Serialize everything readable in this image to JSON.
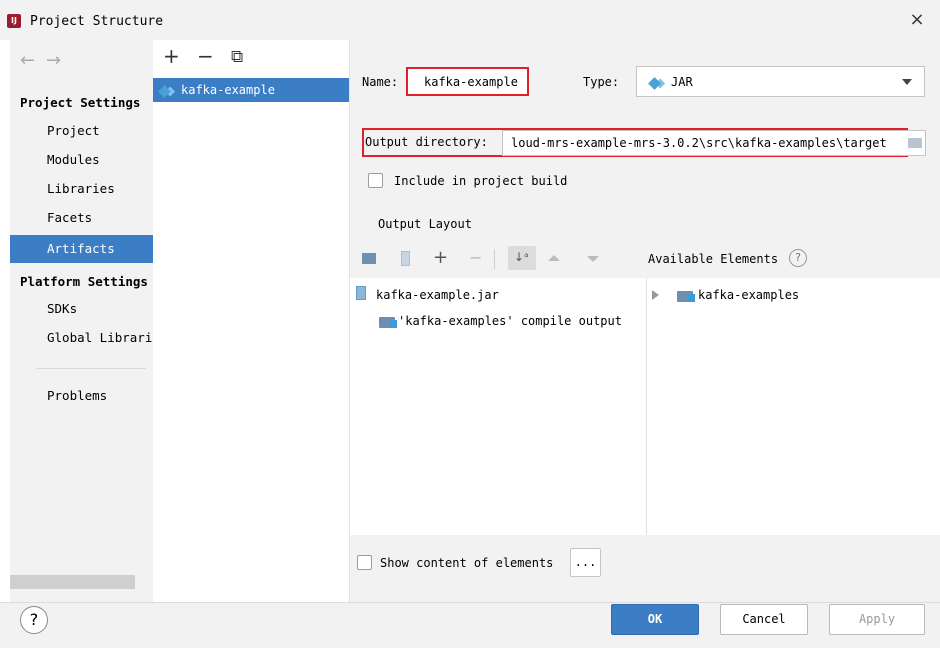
{
  "window": {
    "title": "Project Structure",
    "close_icon": "×"
  },
  "nav": {
    "back_icon": "←",
    "forward_icon": "→",
    "project_settings_heading": "Project Settings",
    "project_settings_items": [
      "Project",
      "Modules",
      "Libraries",
      "Facets",
      "Artifacts"
    ],
    "platform_settings_heading": "Platform Settings",
    "platform_settings_items": [
      "SDKs",
      "Global Librarie"
    ],
    "problems": "Problems",
    "selected": "Artifacts"
  },
  "artifact_list": {
    "add_icon": "+",
    "remove_icon": "−",
    "copy_icon": "⧉",
    "items": [
      "kafka-example"
    ]
  },
  "form": {
    "name_label": "Name:",
    "name_value": "kafka-example",
    "type_label": "Type:",
    "type_value": "JAR",
    "output_dir_label": "Output directory:",
    "output_dir_value": "loud-mrs-example-mrs-3.0.2\\src\\kafka-examples\\target",
    "include_build_label": "Include in project build",
    "include_build_checked": false,
    "output_layout_label": "Output Layout"
  },
  "layout_tree": {
    "root": "kafka-example.jar",
    "child": "'kafka-examples' compile output"
  },
  "available": {
    "heading": "Available Elements",
    "help_icon": "?",
    "items": [
      "kafka-examples"
    ]
  },
  "show_content": {
    "label": "Show content of elements",
    "checked": false,
    "more_button": "..."
  },
  "footer": {
    "help_icon": "?",
    "ok": "OK",
    "cancel": "Cancel",
    "apply": "Apply"
  },
  "colors": {
    "accent": "#3c7ec6",
    "highlight_box": "#e0202a",
    "panel_bg": "#f2f2f2"
  }
}
